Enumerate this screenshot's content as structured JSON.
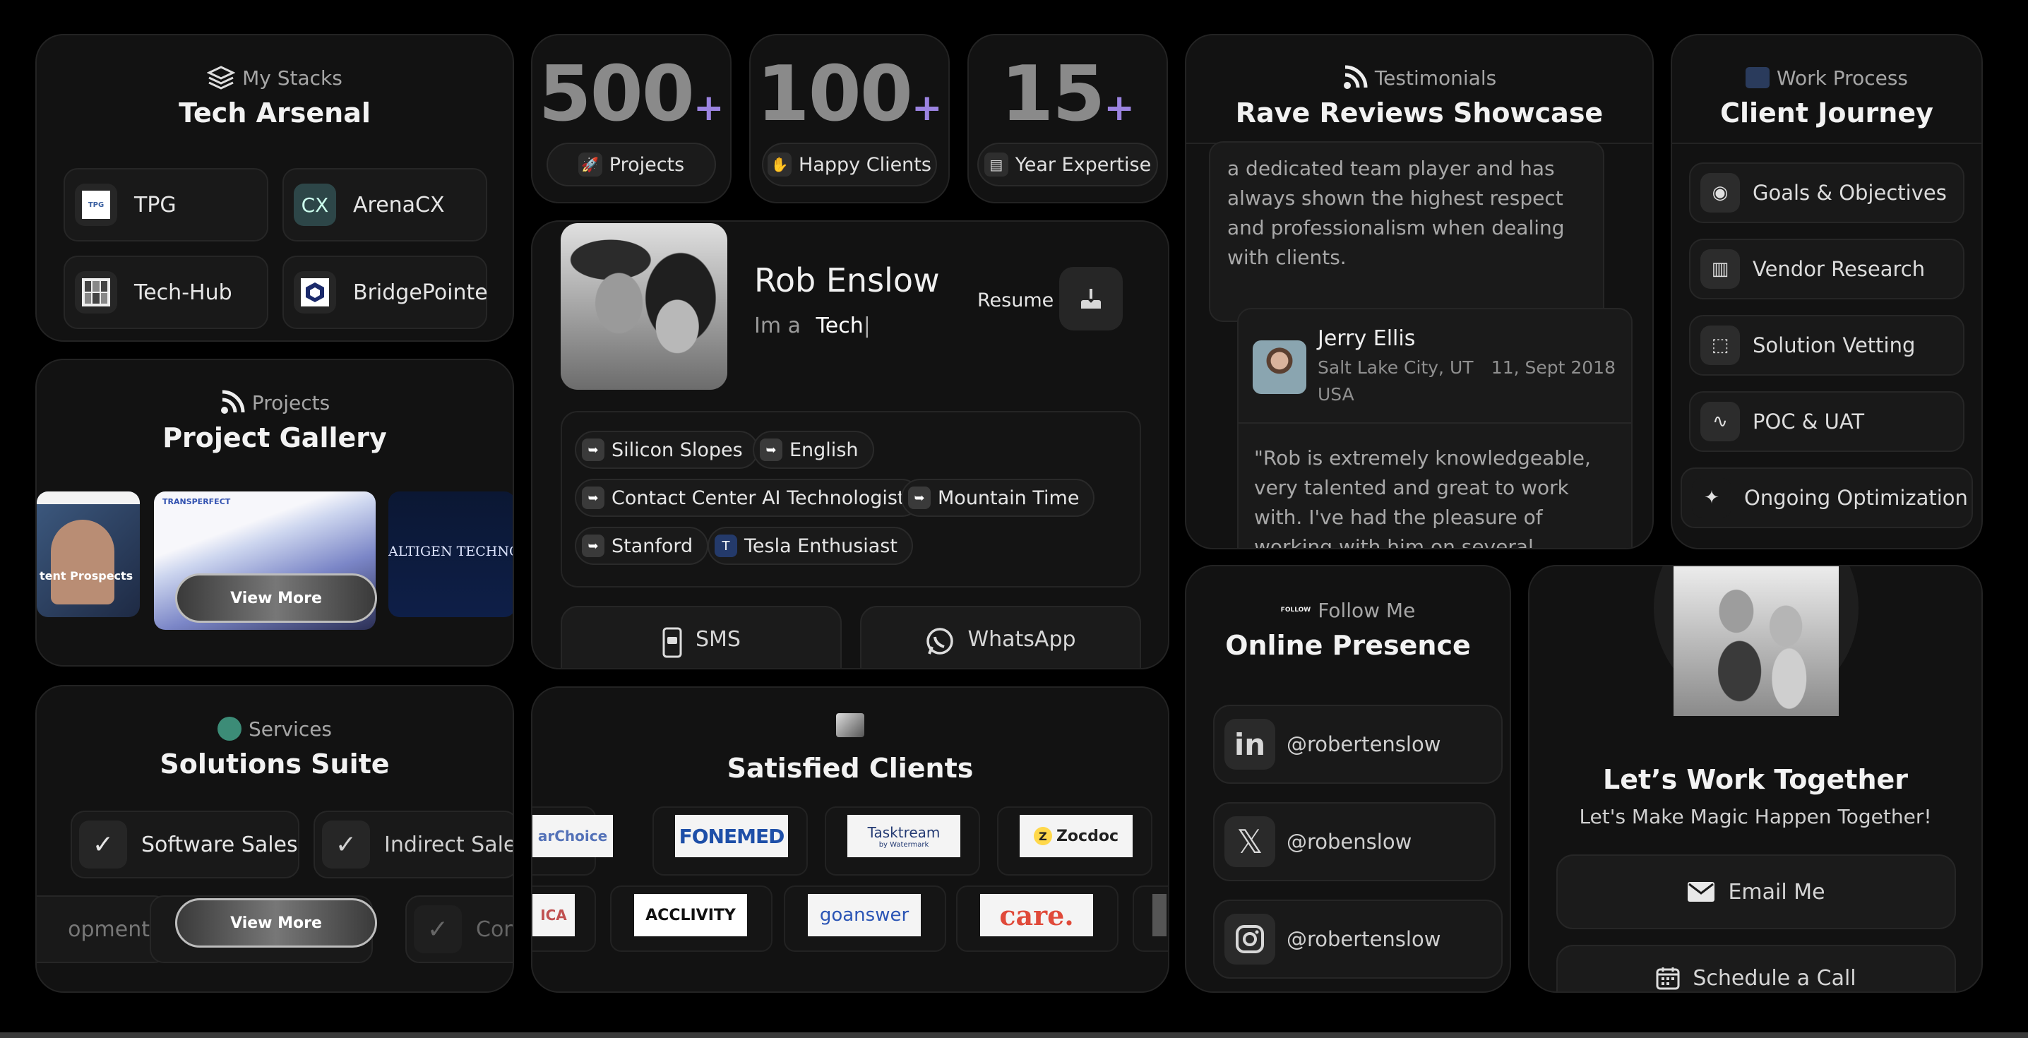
{
  "stacks": {
    "eyebrow": "My Stacks",
    "title": "Tech Arsenal",
    "items": [
      {
        "label": "TPG",
        "icon": "tpg-logo-icon"
      },
      {
        "label": "ArenaCX",
        "icon": "cx-logo-icon",
        "badge": "CX"
      },
      {
        "label": "Tech-Hub",
        "icon": "techhub-logo-icon"
      },
      {
        "label": "BridgePointe",
        "icon": "bridgepointe-logo-icon"
      }
    ]
  },
  "stats": [
    {
      "value": "500",
      "plus": "+",
      "label": "Projects"
    },
    {
      "value": "100",
      "plus": "+",
      "label": "Happy Clients"
    },
    {
      "value": "15",
      "plus": "+",
      "label": "Year Expertise"
    }
  ],
  "testimonials": {
    "eyebrow": "Testimonials",
    "title": "Rave Reviews Showcase",
    "partial_quote": "a dedicated team player and has always shown the highest respect and professionalism when dealing with clients.",
    "review": {
      "name": "Jerry Ellis",
      "location_line1": "Salt Lake City, UT",
      "location_line2": "USA",
      "date": "11, Sept 2018",
      "quote": "\"Rob is extremely knowledgeable, very talented and great to work with. I've had the pleasure of working with him on several projects and each has been"
    }
  },
  "process": {
    "eyebrow": "Work Process",
    "title": "Client Journey",
    "steps": [
      {
        "label": "Goals & Objectives",
        "icon": "target-icon"
      },
      {
        "label": "Vendor Research",
        "icon": "research-icon"
      },
      {
        "label": "Solution Vetting",
        "icon": "vetting-icon"
      },
      {
        "label": "POC & UAT",
        "icon": "poc-icon"
      },
      {
        "label": "Ongoing Optimization",
        "icon": "wand-icon"
      }
    ]
  },
  "profile": {
    "name": "Rob Enslow",
    "tagline_prefix": "Im a",
    "tagline_word": "Tech",
    "resume_label": "Resume",
    "tags": [
      "Silicon Slopes",
      "English",
      "Contact Center AI Technologist",
      "Mountain Time",
      "Stanford",
      "Tesla Enthusiast"
    ],
    "sms_label": "SMS",
    "whatsapp_label": "WhatsApp"
  },
  "projects": {
    "eyebrow": "Projects",
    "title": "Project Gallery",
    "view_more": "View More",
    "thumb1_text": "tent Prospects",
    "thumb2_brand": "TRANSPERFECT",
    "thumb3_text": "ALTIGEN TECHNOLO"
  },
  "services": {
    "eyebrow": "Services",
    "title": "Solutions Suite",
    "row1": [
      "Software Sales",
      "Indirect Sales"
    ],
    "row2": [
      "opment",
      "Con"
    ],
    "view_more": "View More"
  },
  "clients": {
    "title": "Satisfied Clients",
    "row1": [
      "arChoice",
      "FONEMED",
      "Tasktream",
      "Zocdoc"
    ],
    "tasktream_sub": "by Watermark",
    "row2": [
      "ICA",
      "ACCLIVITY",
      "goanswer",
      "care."
    ]
  },
  "follow": {
    "eyebrow": "Follow Me",
    "badge": "FOLLOW",
    "title": "Online Presence",
    "accounts": [
      {
        "handle": "@robertenslow",
        "icon": "linkedin-icon"
      },
      {
        "handle": "@robenslow",
        "icon": "x-icon"
      },
      {
        "handle": "@robertenslow",
        "icon": "instagram-icon"
      }
    ]
  },
  "cta": {
    "title": "Let’s Work Together",
    "subtitle": "Let's Make Magic Happen Together!",
    "email_label": "Email Me",
    "schedule_label": "Schedule a Call"
  },
  "colors": {
    "background": "#000000",
    "card": "#121212",
    "accent": "#9b83e0"
  }
}
